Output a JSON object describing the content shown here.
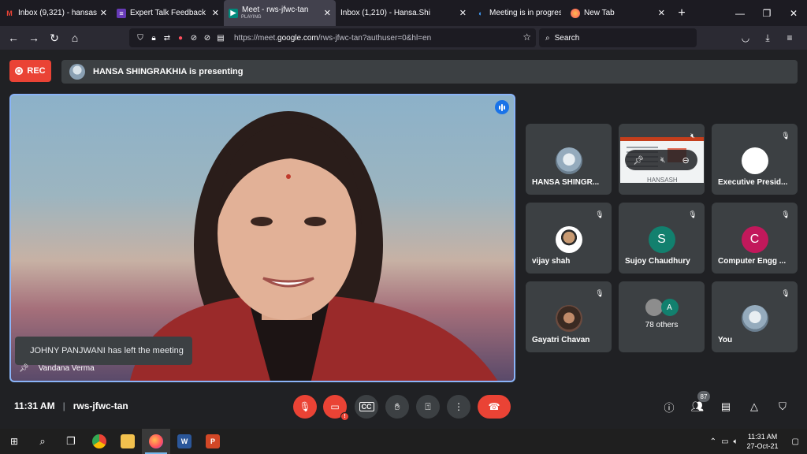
{
  "browser": {
    "tabs": [
      {
        "title": "Inbox (9,321) - hansashin",
        "favicon": "gmail-icon",
        "active": false
      },
      {
        "title": "Expert Talk Feedback",
        "favicon": "forms-icon",
        "active": false
      },
      {
        "title": "Meet - rws-jfwc-tan",
        "subtitle": "PLAYING",
        "favicon": "meet-icon",
        "active": true
      },
      {
        "title": "Inbox (1,210) - Hansa.Shi",
        "favicon": "outlook-icon",
        "active": false
      },
      {
        "title": "Meeting is in progress...",
        "favicon": "webex-icon",
        "active": false
      },
      {
        "title": "New Tab",
        "favicon": "firefox-icon",
        "active": false
      }
    ],
    "url_prefix": "https://meet.",
    "url_domain": "google.com",
    "url_suffix": "/rws-jfwc-tan?authuser=0&hl=en",
    "search_placeholder": "Search"
  },
  "meeting": {
    "rec_label": "REC",
    "presenting_text": "HANSA SHINGRAKHIA is presenting",
    "main_video_name": "Vandana Verma",
    "toast": "JOHNY PANJWANI has left the meeting",
    "time": "11:31 AM",
    "code": "rws-jfwc-tan",
    "participant_count": "87",
    "tiles": [
      {
        "name": "HANSA SHINGR...",
        "type": "photo"
      },
      {
        "name": "",
        "type": "share"
      },
      {
        "name": "Executive Presid...",
        "type": "white"
      },
      {
        "name": "vijay shah",
        "type": "vijay"
      },
      {
        "name": "Sujoy Chaudhury",
        "type": "letter",
        "letter": "S"
      },
      {
        "name": "Computer Engg ...",
        "type": "letter",
        "letter": "C"
      },
      {
        "name": "Gayatri Chavan",
        "type": "gayatri"
      },
      {
        "name": "78 others",
        "type": "others",
        "letter": "A"
      },
      {
        "name": "You",
        "type": "photo"
      }
    ],
    "share_caption": "HANSASH"
  },
  "taskbar": {
    "time": "11:31 AM",
    "date": "27-Oct-21"
  },
  "colors": {
    "accent_blue": "#8ab4f8",
    "red": "#ea4335",
    "tile_bg": "#3c4043",
    "bg": "#202124"
  }
}
